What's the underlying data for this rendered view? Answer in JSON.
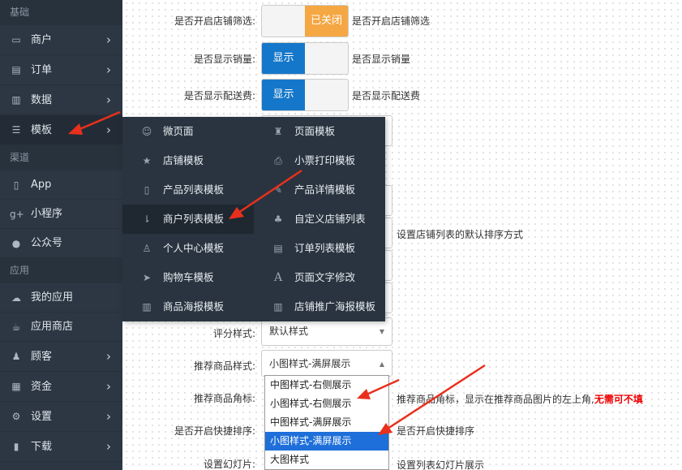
{
  "sidebar": {
    "section_basic": "基础",
    "section_channel": "渠道",
    "section_app": "应用",
    "items": {
      "merchant": "商户",
      "order": "订单",
      "data": "数据",
      "template": "模板",
      "app": "App",
      "miniprogram": "小程序",
      "official": "公众号",
      "myapps": "我的应用",
      "appstore": "应用商店",
      "customer": "顾客",
      "funds": "资金",
      "settings": "设置",
      "download": "下载"
    }
  },
  "flyout": {
    "micro_page": "微页面",
    "page_template": "页面模板",
    "store_template": "店铺模板",
    "receipt_print_template": "小票打印模板",
    "product_list_template": "产品列表模板",
    "product_detail_template": "产品详情模板",
    "merchant_list_template": "商户列表模板",
    "custom_store_list": "自定义店铺列表",
    "user_center_template": "个人中心模板",
    "order_list_template": "订单列表模板",
    "cart_template": "购物车模板",
    "page_text_edit": "页面文字修改",
    "product_poster_template": "商品海报模板",
    "store_promo_poster_template": "店铺推广海报模板"
  },
  "form": {
    "store_filter_label": "是否开启店铺筛选:",
    "store_filter_toggle": "已关闭",
    "store_filter_help": "是否开启店铺筛选",
    "show_sales_label": "是否显示销量:",
    "show_sales_toggle": "显示",
    "show_sales_help": "是否显示销量",
    "show_delivery_label": "是否显示配送费:",
    "show_delivery_toggle": "显示",
    "show_delivery_help": "是否显示配送费",
    "default_sort_help": "设置店铺列表的默认排序方式",
    "rating_style_label": "评分样式:",
    "rating_style_value": "默认样式",
    "recommend_style_label": "推荐商品样式:",
    "recommend_style_value": "小图样式-满屏展示",
    "recommend_corner_label": "推荐商品角标:",
    "recommend_corner_help": "推荐商品角标，显示在推荐商品图片的左上角,",
    "recommend_corner_help_red": "无需可不填",
    "quick_sort_label": "是否开启快捷排序:",
    "quick_sort_help": "是否开启快捷排序",
    "slideshow_label": "设置幻灯片:",
    "slideshow_help": "设置列表幻灯片展示"
  },
  "dropdown": {
    "options": [
      "中图样式-右侧展示",
      "小图样式-右侧展示",
      "中图样式-满屏展示",
      "小图样式-满屏展示",
      "大图样式"
    ],
    "selected_index": 3
  },
  "colors": {
    "sidebar_bg": "#2c3743",
    "toggle_on": "#1577c9",
    "toggle_off": "#f5a743",
    "arrow": "#e8301c",
    "option_selected": "#1e6fd9"
  }
}
